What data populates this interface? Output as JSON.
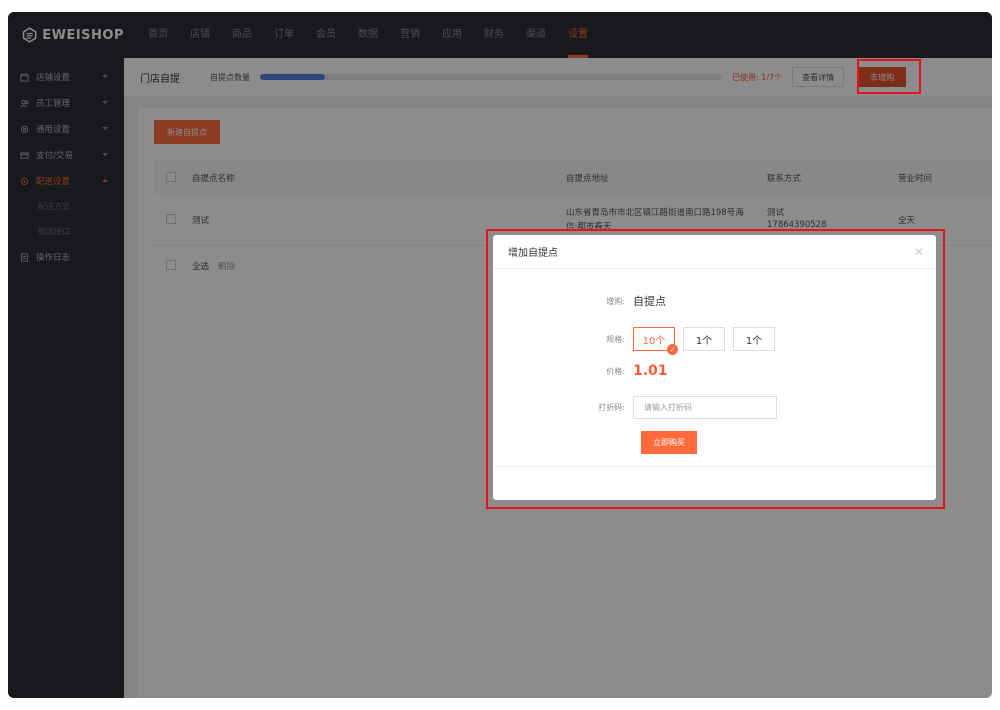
{
  "brand": {
    "name": "EWEISHOP",
    "accent": "#ff6a3d"
  },
  "topnav": {
    "items": [
      "首页",
      "店铺",
      "商品",
      "订单",
      "会员",
      "数据",
      "营销",
      "应用",
      "财务",
      "渠道",
      "设置"
    ],
    "active": "设置"
  },
  "sidebar": {
    "items": [
      {
        "label": "店铺设置",
        "icon": "shop-icon"
      },
      {
        "label": "员工管理",
        "icon": "staff-icon"
      },
      {
        "label": "通用设置",
        "icon": "settings-icon"
      },
      {
        "label": "支付/交易",
        "icon": "card-icon"
      },
      {
        "label": "配送设置",
        "icon": "delivery-icon",
        "active": true
      },
      {
        "label": "配送方式"
      },
      {
        "label": "物流接口"
      },
      {
        "label": "操作日志",
        "icon": "log-icon"
      }
    ]
  },
  "subbar": {
    "title": "门店自提",
    "quota_label": "自提点数量",
    "quota_fraction": 0.14,
    "used_text": "已使用: 1/7个",
    "detail_button": "查看详情",
    "buy_button": "去增购"
  },
  "table": {
    "new_button": "新建自提点",
    "headers": [
      "自提点名称",
      "自提点地址",
      "联系方式",
      "营业时间"
    ],
    "rows": [
      {
        "name": "测试",
        "address_line1": "山东省青岛市市北区镇江路街道南口路198号海",
        "address_line2": "信·都市春天",
        "contact_name": "测试",
        "contact_phone": "17864390528",
        "hours": "全天"
      }
    ],
    "select_all": "全选",
    "delete": "删除"
  },
  "modal": {
    "title": "增加自提点",
    "purchase_label": "增购:",
    "purchase_value": "自提点",
    "spec_label": "规格:",
    "specs": [
      "10个",
      "1个",
      "1个"
    ],
    "selected_spec": "10个",
    "price_label": "价格:",
    "price_value": "1.01",
    "code_label": "打折码:",
    "code_placeholder": "请输入打折码",
    "buy_now": "立即购买"
  }
}
